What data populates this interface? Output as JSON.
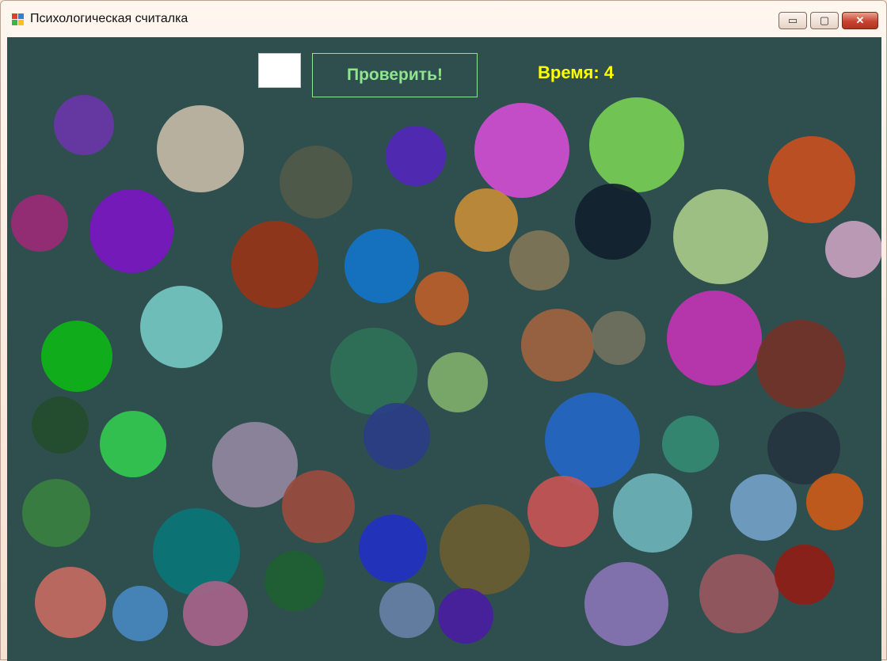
{
  "window": {
    "title": "Психологическая считалка",
    "minimize_label": "▭",
    "maximize_label": "▢",
    "close_label": "✕"
  },
  "toolbar": {
    "answer_value": "",
    "check_label": "Проверить!",
    "timer_label": "Время: 4"
  },
  "colors": {
    "background": "#2f4f4f",
    "button_text": "#8fe68f",
    "timer_text": "#ffff00"
  },
  "circles": [
    {
      "color": "#6a35a8"
    },
    {
      "color": "#c4b8a5"
    },
    {
      "color": "#535a49"
    },
    {
      "color": "#5226b8"
    },
    {
      "color": "#d04dd0"
    },
    {
      "color": "#77ce55"
    },
    {
      "color": "#c54f1f"
    },
    {
      "color": "#9c2a76"
    },
    {
      "color": "#7a16c2"
    },
    {
      "color": "#963418"
    },
    {
      "color": "#1474c7"
    },
    {
      "color": "#c48c38"
    },
    {
      "color": "#12202e"
    },
    {
      "color": "#a7c989"
    },
    {
      "color": "#c6a0bd"
    },
    {
      "color": "#807558"
    },
    {
      "color": "#bb5e2a"
    },
    {
      "color": "#75c7c1"
    },
    {
      "color": "#0fb418"
    },
    {
      "color": "#2f7158"
    },
    {
      "color": "#7eae6a"
    },
    {
      "color": "#a0633f"
    },
    {
      "color": "#72715e"
    },
    {
      "color": "#c034b2"
    },
    {
      "color": "#733229"
    },
    {
      "color": "#244c2c"
    },
    {
      "color": "#33c950"
    },
    {
      "color": "#2a3d85"
    },
    {
      "color": "#9287a0"
    },
    {
      "color": "#2566c4"
    },
    {
      "color": "#358a73"
    },
    {
      "color": "#263440"
    },
    {
      "color": "#3a8040"
    },
    {
      "color": "#9b4b3e"
    },
    {
      "color": "#0b7577"
    },
    {
      "color": "#2331c2"
    },
    {
      "color": "#6a5d32"
    },
    {
      "color": "#c75555"
    },
    {
      "color": "#6db3b8"
    },
    {
      "color": "#739fc6"
    },
    {
      "color": "#ca5a19"
    },
    {
      "color": "#206032"
    },
    {
      "color": "#c46a60"
    },
    {
      "color": "#4888c0"
    },
    {
      "color": "#a66389"
    },
    {
      "color": "#6780a6"
    },
    {
      "color": "#4a1d9f"
    },
    {
      "color": "#8874b4"
    },
    {
      "color": "#98575f"
    },
    {
      "color": "#911d17"
    }
  ]
}
